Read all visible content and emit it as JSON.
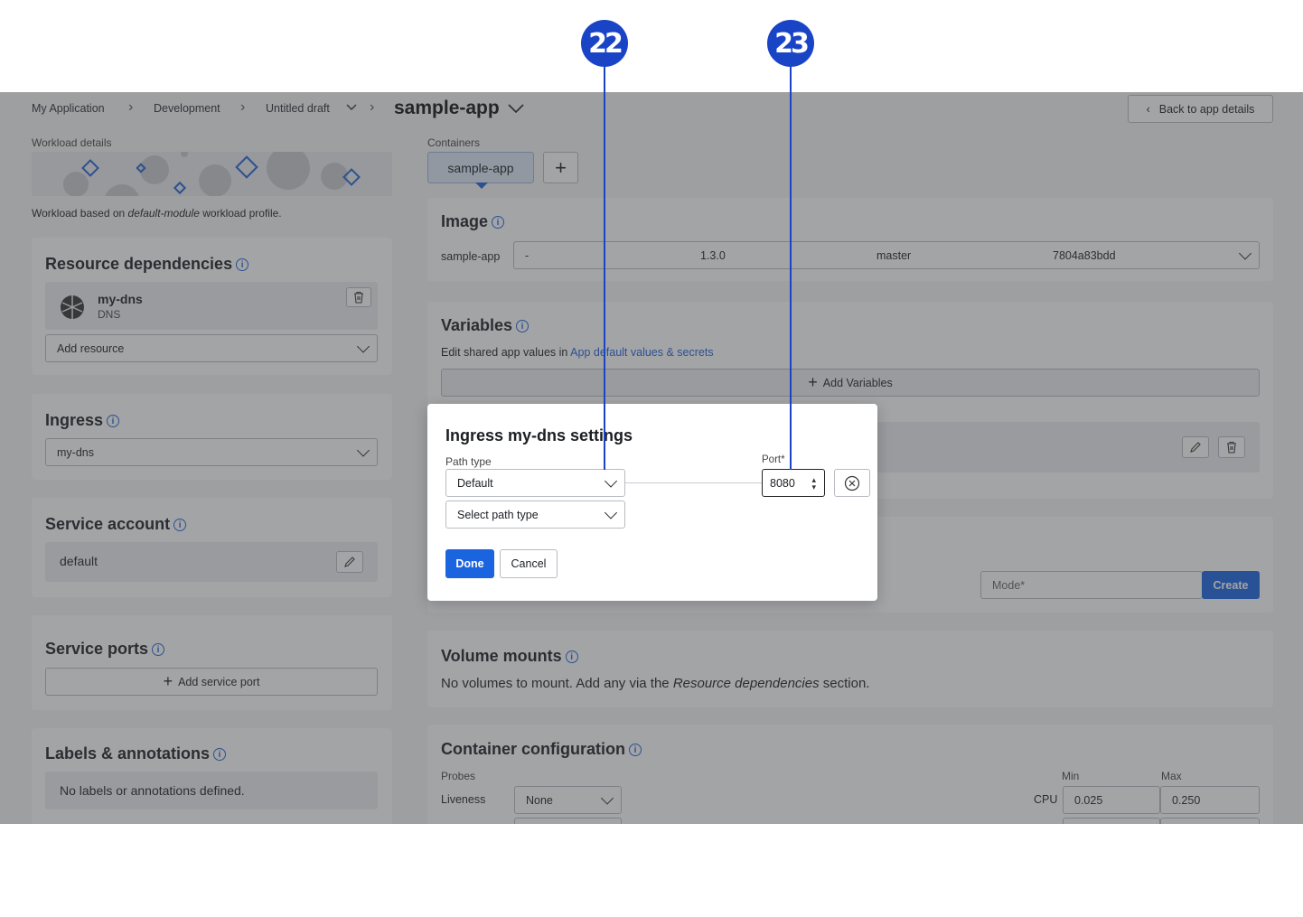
{
  "callouts": [
    "22",
    "23"
  ],
  "breadcrumb": {
    "items": [
      "My Application",
      "Development",
      "Untitled draft"
    ],
    "current": "sample-app",
    "back_label": "Back to app details"
  },
  "workload": {
    "section_label": "Workload details",
    "description_prefix": "Workload based on ",
    "description_module": "default-module",
    "description_suffix": " workload profile."
  },
  "resource_dependencies": {
    "title": "Resource dependencies",
    "item_name": "my-dns",
    "item_type": "DNS",
    "add_placeholder": "Add resource"
  },
  "ingress": {
    "title": "Ingress",
    "selected": "my-dns"
  },
  "service_account": {
    "title": "Service account",
    "value": "default"
  },
  "service_ports": {
    "title": "Service ports",
    "add_label": "Add service port"
  },
  "labels": {
    "title": "Labels & annotations",
    "empty_text": "No labels or annotations defined."
  },
  "containers": {
    "section_label": "Containers",
    "tab": "sample-app",
    "add_symbol": "+"
  },
  "image": {
    "title": "Image",
    "name": "sample-app",
    "col1": "-",
    "version": "1.3.0",
    "branch": "master",
    "commit": "7804a83bdd"
  },
  "variables": {
    "title": "Variables",
    "edit_prefix": "Edit shared app values in ",
    "edit_link": "App default values & secrets",
    "add_label": "Add Variables"
  },
  "files": {
    "mode_placeholder": "Mode*",
    "create_label": "Create"
  },
  "volume_mounts": {
    "title": "Volume mounts",
    "text_prefix": "No volumes to mount. Add any via the ",
    "text_em": "Resource dependencies",
    "text_suffix": " section."
  },
  "container_config": {
    "title": "Container configuration",
    "probes_label": "Probes",
    "liveness_label": "Liveness",
    "liveness_value": "None",
    "min_label": "Min",
    "max_label": "Max",
    "cpu_label": "CPU",
    "cpu_min": "0.025",
    "cpu_max": "0.250"
  },
  "modal": {
    "title": "Ingress my-dns settings",
    "path_type_label": "Path type",
    "path_type_value": "Default",
    "port_label": "Port*",
    "port_value": "8080",
    "select_path_placeholder": "Select path type",
    "done_label": "Done",
    "cancel_label": "Cancel"
  },
  "colors": {
    "accent": "#1a64e0",
    "callout": "#1a44c6",
    "link": "#1f62d6"
  }
}
